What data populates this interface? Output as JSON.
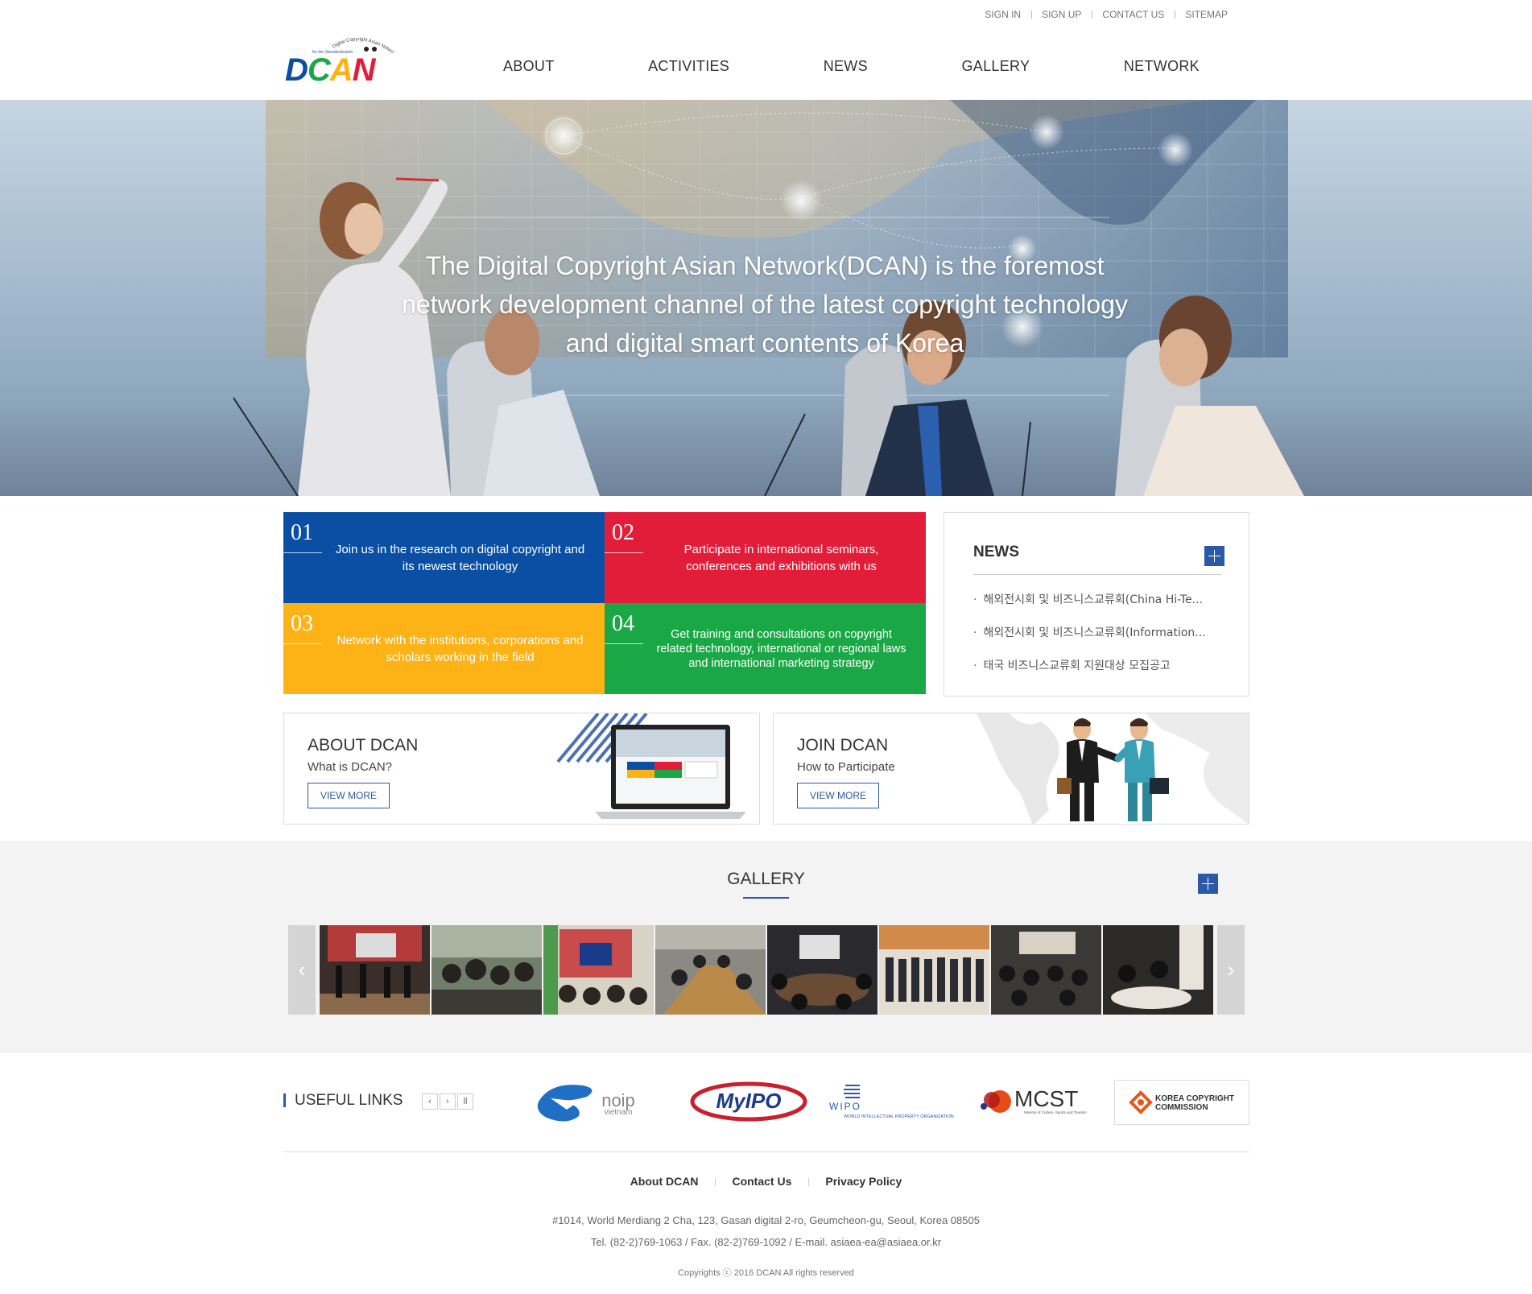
{
  "top_links": [
    "SIGN IN",
    "SIGN UP",
    "CONTACT US",
    "SITEMAP"
  ],
  "logo": {
    "text": "DCAN",
    "tagline": "for the Standardization",
    "arc": "Digital Copyright Asian Network"
  },
  "nav": [
    "ABOUT",
    "ACTIVITIES",
    "NEWS",
    "GALLERY",
    "NETWORK"
  ],
  "hero": {
    "line1": "The Digital Copyright Asian Network(DCAN) is the foremost",
    "line2": "network development channel of the latest copyright technology",
    "line3": "and digital smart contents of Korea"
  },
  "tiles": [
    {
      "num": "01",
      "text": "Join us in the research on digital copyright and its newest technology",
      "color": "#0a4fa3"
    },
    {
      "num": "02",
      "text": "Participate in international seminars, conferences and exhibitions with us",
      "color": "#e21d3a"
    },
    {
      "num": "03",
      "text": "Network with the institutions, corporations and scholars working in the field",
      "color": "#fdb215"
    },
    {
      "num": "04",
      "text": "Get training and consultations on copyright related technology, international or regional laws and international marketing strategy",
      "color": "#1aa846"
    }
  ],
  "news": {
    "title": "NEWS",
    "items": [
      "해외전시회 및 비즈니스교류회(China Hi-Te...",
      "해외전시회 및 비즈니스교류회(Information...",
      "태국 비즈니스교류회 지원대상 모집공고"
    ]
  },
  "about": {
    "title": "ABOUT DCAN",
    "subtitle": "What is DCAN?",
    "button": "VIEW MORE"
  },
  "join": {
    "title": "JOIN DCAN",
    "subtitle": "How to Participate",
    "button": "VIEW MORE"
  },
  "gallery": {
    "title": "GALLERY",
    "prev": "‹",
    "next": "›"
  },
  "useful_links": {
    "title": "USEFUL LINKS",
    "controls": [
      "‹",
      "›",
      "ll"
    ],
    "partners": [
      {
        "name": "noip",
        "sub": "vietnam"
      },
      {
        "name": "MyIPO"
      },
      {
        "name": "WIPO",
        "sub": "WORLD INTELLECTUAL PROPERTY ORGANIZATION"
      },
      {
        "name": "MCST",
        "sub": "Ministry of Culture, Sports and Tourism"
      },
      {
        "name": "KOREA COPYRIGHT",
        "sub": "COMMISSION"
      }
    ]
  },
  "footer": {
    "links": [
      "About DCAN",
      "Contact Us",
      "Privacy Policy"
    ],
    "address": "#1014, World Merdiang 2 Cha, 123, Gasan digital 2-ro, Geumcheon-gu, Seoul, Korea 08505",
    "contact": "Tel. (82-2)769-1063 / Fax. (82-2)769-1092 / E-mail. asiaea-ea@asiaea.or.kr",
    "copyright": "Copyrights ⓒ 2016 DCAN All rights reserved"
  },
  "colors": {
    "accent": "#2c58a8",
    "blue": "#0a4fa3",
    "red": "#e21d3a",
    "yellow": "#fdb215",
    "green": "#1aa846"
  }
}
